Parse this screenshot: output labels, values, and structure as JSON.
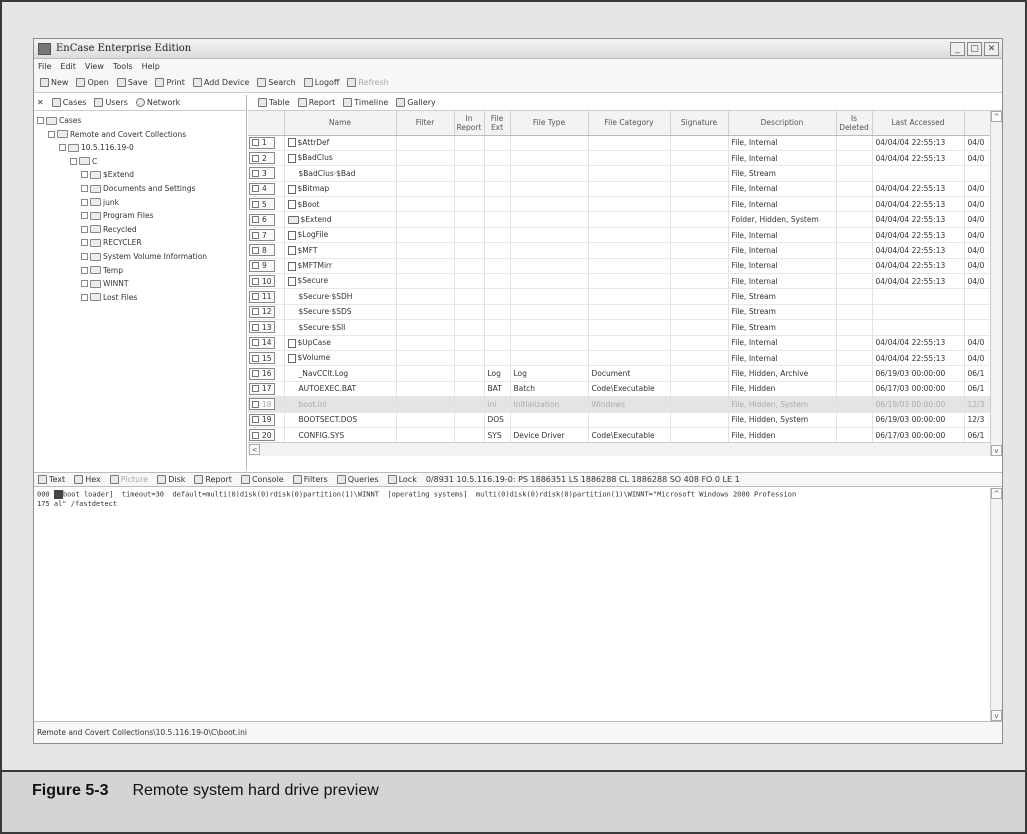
{
  "window": {
    "title": "EnCase Enterprise Edition"
  },
  "menu": [
    "File",
    "Edit",
    "View",
    "Tools",
    "Help"
  ],
  "toolbar": [
    {
      "label": "New",
      "icon": "new-doc-icon",
      "enabled": true
    },
    {
      "label": "Open",
      "icon": "open-folder-icon",
      "enabled": true
    },
    {
      "label": "Save",
      "icon": "save-disk-icon",
      "enabled": true
    },
    {
      "label": "Print",
      "icon": "printer-icon",
      "enabled": true
    },
    {
      "label": "Add Device",
      "icon": "add-device-icon",
      "enabled": true
    },
    {
      "label": "Search",
      "icon": "search-icon",
      "enabled": true
    },
    {
      "label": "Logoff",
      "icon": "logoff-icon",
      "enabled": true
    },
    {
      "label": "Refresh",
      "icon": "refresh-icon",
      "enabled": false
    }
  ],
  "left_tabs": [
    "Cases",
    "Users",
    "Network"
  ],
  "tree": [
    {
      "label": "Cases",
      "depth": 0
    },
    {
      "label": "Remote and Covert Collections",
      "depth": 1
    },
    {
      "label": "10.5.116.19-0",
      "depth": 2
    },
    {
      "label": "C",
      "depth": 3
    },
    {
      "label": "$Extend",
      "depth": 4
    },
    {
      "label": "Documents and Settings",
      "depth": 4
    },
    {
      "label": "junk",
      "depth": 4
    },
    {
      "label": "Program Files",
      "depth": 4
    },
    {
      "label": "Recycled",
      "depth": 4
    },
    {
      "label": "RECYCLER",
      "depth": 4
    },
    {
      "label": "System Volume Information",
      "depth": 4
    },
    {
      "label": "Temp",
      "depth": 4
    },
    {
      "label": "WINNT",
      "depth": 4
    },
    {
      "label": "Lost Files",
      "depth": 4
    }
  ],
  "view_tabs": [
    "Table",
    "Report",
    "Timeline",
    "Gallery"
  ],
  "columns": [
    "",
    "Name",
    "Filter",
    "In Report",
    "File Ext",
    "File Type",
    "File Category",
    "Signature",
    "Description",
    "Is Deleted",
    "Last Accessed",
    ""
  ],
  "rows": [
    {
      "n": "1",
      "name": "$AttrDef",
      "icon": "file",
      "ext": "",
      "type": "",
      "cat": "",
      "desc": "File, Internal",
      "acc": "04/04/04 22:55:13",
      "extra": "04/0"
    },
    {
      "n": "2",
      "name": "$BadClus",
      "icon": "file",
      "ext": "",
      "type": "",
      "cat": "",
      "desc": "File, Internal",
      "acc": "04/04/04 22:55:13",
      "extra": "04/0"
    },
    {
      "n": "3",
      "name": "$BadClus·$Bad",
      "icon": "none",
      "ext": "",
      "type": "",
      "cat": "",
      "desc": "File, Stream",
      "acc": "",
      "extra": ""
    },
    {
      "n": "4",
      "name": "$Bitmap",
      "icon": "file",
      "ext": "",
      "type": "",
      "cat": "",
      "desc": "File, Internal",
      "acc": "04/04/04 22:55:13",
      "extra": "04/0"
    },
    {
      "n": "5",
      "name": "$Boot",
      "icon": "file",
      "ext": "",
      "type": "",
      "cat": "",
      "desc": "File, Internal",
      "acc": "04/04/04 22:55:13",
      "extra": "04/0"
    },
    {
      "n": "6",
      "name": "$Extend",
      "icon": "folder",
      "ext": "",
      "type": "",
      "cat": "",
      "desc": "Folder, Hidden, System",
      "acc": "04/04/04 22:55:13",
      "extra": "04/0"
    },
    {
      "n": "7",
      "name": "$LogFile",
      "icon": "file",
      "ext": "",
      "type": "",
      "cat": "",
      "desc": "File, Internal",
      "acc": "04/04/04 22:55:13",
      "extra": "04/0"
    },
    {
      "n": "8",
      "name": "$MFT",
      "icon": "file",
      "ext": "",
      "type": "",
      "cat": "",
      "desc": "File, Internal",
      "acc": "04/04/04 22:55:13",
      "extra": "04/0"
    },
    {
      "n": "9",
      "name": "$MFTMirr",
      "icon": "file",
      "ext": "",
      "type": "",
      "cat": "",
      "desc": "File, Internal",
      "acc": "04/04/04 22:55:13",
      "extra": "04/0"
    },
    {
      "n": "10",
      "name": "$Secure",
      "icon": "file",
      "ext": "",
      "type": "",
      "cat": "",
      "desc": "File, Internal",
      "acc": "04/04/04 22:55:13",
      "extra": "04/0"
    },
    {
      "n": "11",
      "name": "$Secure·$SDH",
      "icon": "none",
      "ext": "",
      "type": "",
      "cat": "",
      "desc": "File, Stream",
      "acc": "",
      "extra": ""
    },
    {
      "n": "12",
      "name": "$Secure·$SDS",
      "icon": "none",
      "ext": "",
      "type": "",
      "cat": "",
      "desc": "File, Stream",
      "acc": "",
      "extra": ""
    },
    {
      "n": "13",
      "name": "$Secure·$SII",
      "icon": "none",
      "ext": "",
      "type": "",
      "cat": "",
      "desc": "File, Stream",
      "acc": "",
      "extra": ""
    },
    {
      "n": "14",
      "name": "$UpCase",
      "icon": "file",
      "ext": "",
      "type": "",
      "cat": "",
      "desc": "File, Internal",
      "acc": "04/04/04 22:55:13",
      "extra": "04/0"
    },
    {
      "n": "15",
      "name": "$Volume",
      "icon": "file",
      "ext": "",
      "type": "",
      "cat": "",
      "desc": "File, Internal",
      "acc": "04/04/04 22:55:13",
      "extra": "04/0"
    },
    {
      "n": "16",
      "name": "_NavCClt.Log",
      "icon": "none",
      "ext": "Log",
      "type": "Log",
      "cat": "Document",
      "desc": "File, Hidden, Archive",
      "acc": "06/19/03 00:00:00",
      "extra": "06/1"
    },
    {
      "n": "17",
      "name": "AUTOEXEC.BAT",
      "icon": "none",
      "ext": "BAT",
      "type": "Batch",
      "cat": "Code\\Executable",
      "desc": "File, Hidden",
      "acc": "06/17/03 00:00:00",
      "extra": "06/1"
    },
    {
      "n": "18",
      "name": "boot.ini",
      "icon": "none",
      "ext": "ini",
      "type": "Initialization",
      "cat": "Windows",
      "desc": "File, Hidden, System",
      "acc": "06/19/03 00:00:00",
      "extra": "12/3"
    },
    {
      "n": "19",
      "name": "BOOTSECT.DOS",
      "icon": "none",
      "ext": "DOS",
      "type": "",
      "cat": "",
      "desc": "File, Hidden, System",
      "acc": "06/19/03 00:00:00",
      "extra": "12/3"
    },
    {
      "n": "20",
      "name": "CONFIG.SYS",
      "icon": "none",
      "ext": "SYS",
      "type": "Device Driver",
      "cat": "Code\\Executable",
      "desc": "File, Hidden",
      "acc": "06/17/03 00:00:00",
      "extra": "06/1"
    }
  ],
  "selected_row": "18",
  "bottom_tabs": [
    "Text",
    "Hex",
    "Picture",
    "Disk",
    "Report",
    "Console",
    "Filters",
    "Queries",
    "Lock"
  ],
  "bottom_info": "0/8931  10.5.116.19-0: PS 1886351  LS 1886288  CL 1886288  SO 408  FO 0  LE 1",
  "text_pane": {
    "line1_offset": "000",
    "line1": "boot loader]  timeout=30  default=multi(0)disk(0)rdisk(0)partition(1)\\WINNT  [operating systems]  multi(0)disk(0)rdisk(0)partition(1)\\WINNT=\"Microsoft Windows 2000 Profession",
    "line2_offset": "175",
    "line2": "al\" /fastdetect"
  },
  "status_path": "Remote and Covert Collections\\10.5.116.19-0\\C\\boot.ini",
  "caption": {
    "figure": "Figure 5-3",
    "text": "Remote system hard drive preview"
  }
}
